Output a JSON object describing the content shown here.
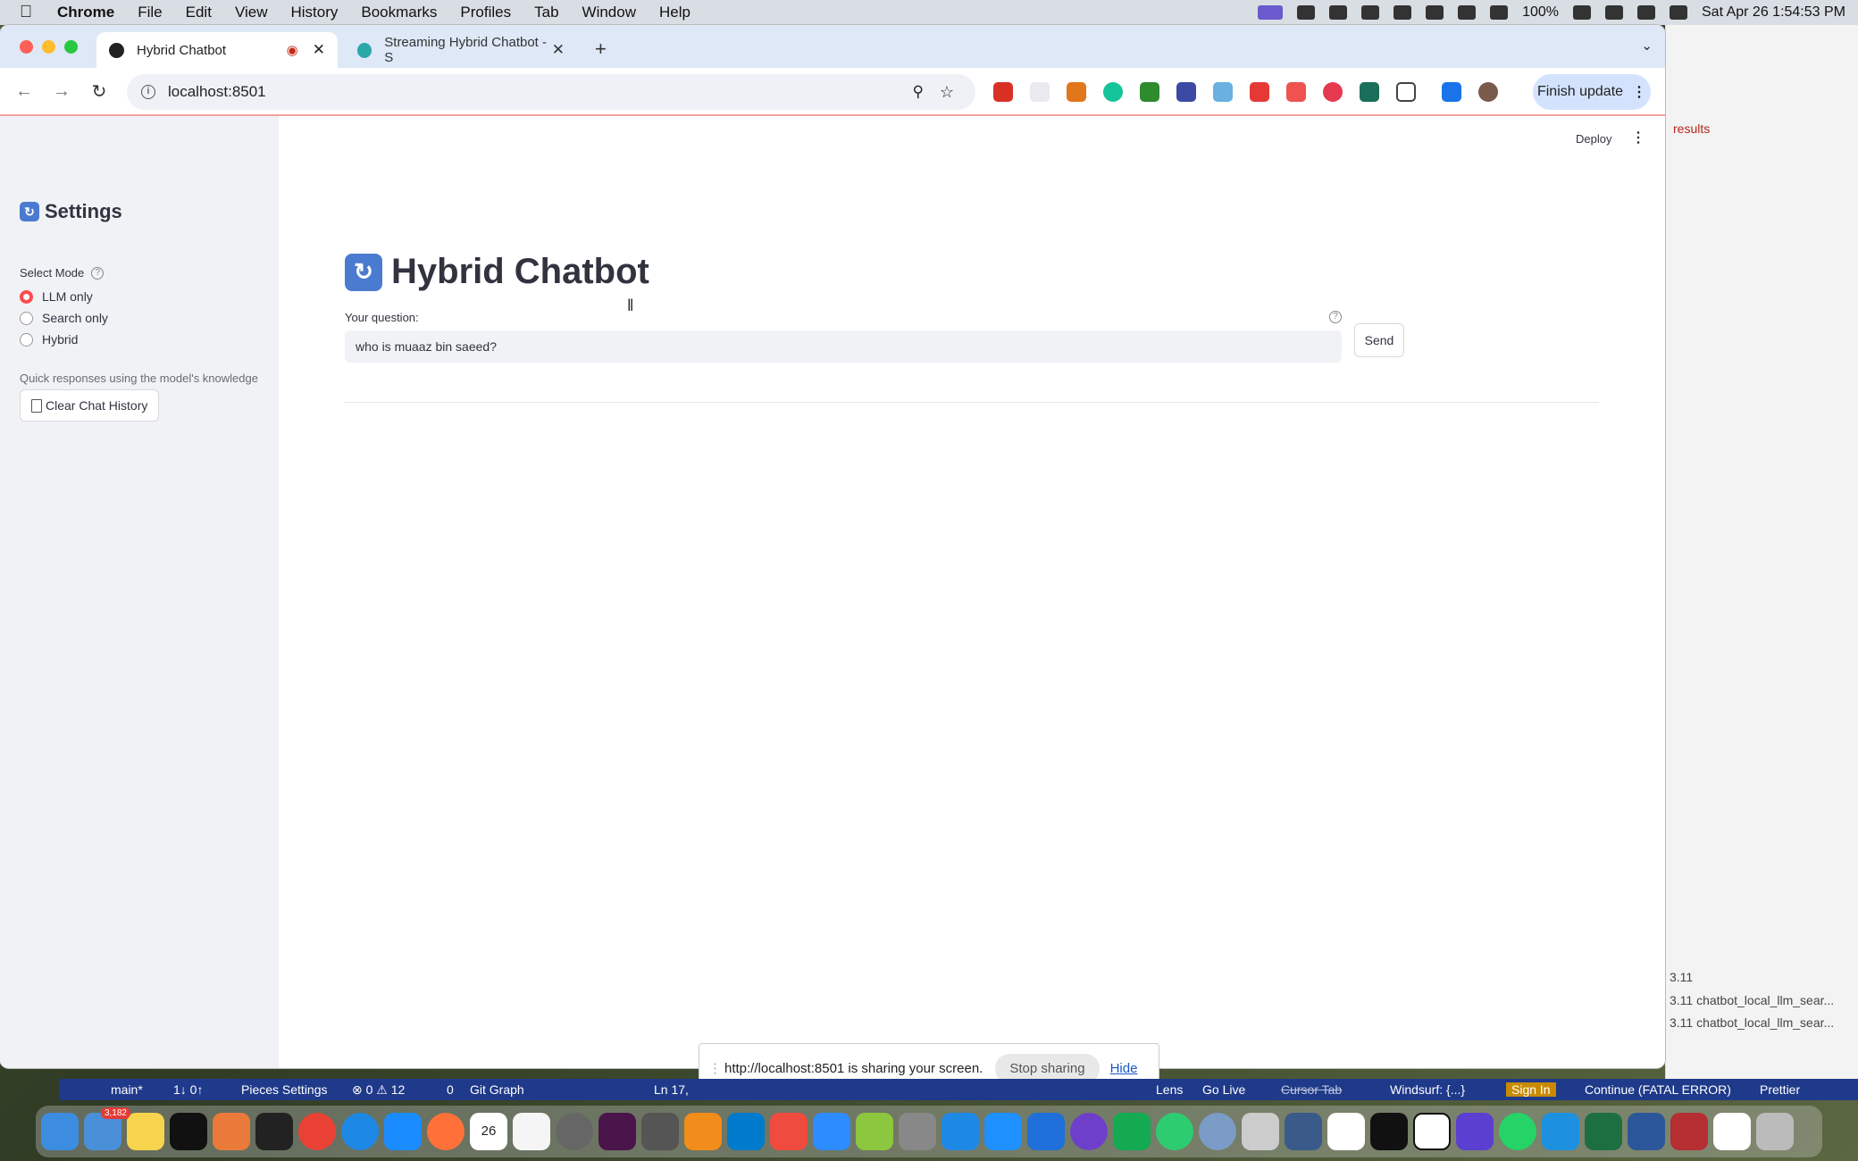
{
  "menubar": {
    "app": "Chrome",
    "items": [
      "File",
      "Edit",
      "View",
      "History",
      "Bookmarks",
      "Profiles",
      "Tab",
      "Window",
      "Help"
    ],
    "battery": "100%",
    "datetime": "Sat Apr 26  1:54:53 PM"
  },
  "tabs": [
    {
      "title": "Hybrid Chatbot",
      "active": true
    },
    {
      "title": "Streaming Hybrid Chatbot - S",
      "active": false
    }
  ],
  "toolbar": {
    "url": "localhost:8501",
    "finish_update": "Finish update"
  },
  "sidebar": {
    "title": "Settings",
    "mode_label": "Select Mode",
    "modes": [
      {
        "label": "LLM only",
        "selected": true
      },
      {
        "label": "Search only",
        "selected": false
      },
      {
        "label": "Hybrid",
        "selected": false
      }
    ],
    "caption": "Quick responses using the model's knowledge",
    "clear_button": "Clear Chat History"
  },
  "header": {
    "deploy": "Deploy"
  },
  "main": {
    "title": "Hybrid Chatbot",
    "question_label": "Your question:",
    "question_value": "who is muaaz bin saeed?",
    "send_label": "Send"
  },
  "share_bar": {
    "message": "http://localhost:8501 is sharing your screen.",
    "stop": "Stop sharing",
    "hide": "Hide"
  },
  "vscode": {
    "results": "results",
    "term1": "3.11",
    "term2": "3.11  chatbot_local_llm_sear...",
    "term3": "3.11  chatbot_local_llm_sear..."
  },
  "statusbar": {
    "branch": "main*",
    "sync": "1↓ 0↑",
    "pieces": "Pieces Settings",
    "problems": "⊗ 0 ⚠ 12",
    "ports": "0",
    "git_graph": "Git Graph",
    "position": "Ln 17,",
    "lens": "Lens",
    "go_live": "Go Live",
    "cursor_tab": "Cursor Tab",
    "windsurf": "Windsurf: {...}",
    "sign_in": "Sign In",
    "continue": "Continue (FATAL ERROR)",
    "prettier": "Prettier"
  },
  "dock": {
    "mail_badge": "3,182",
    "calendar_day": "26"
  }
}
